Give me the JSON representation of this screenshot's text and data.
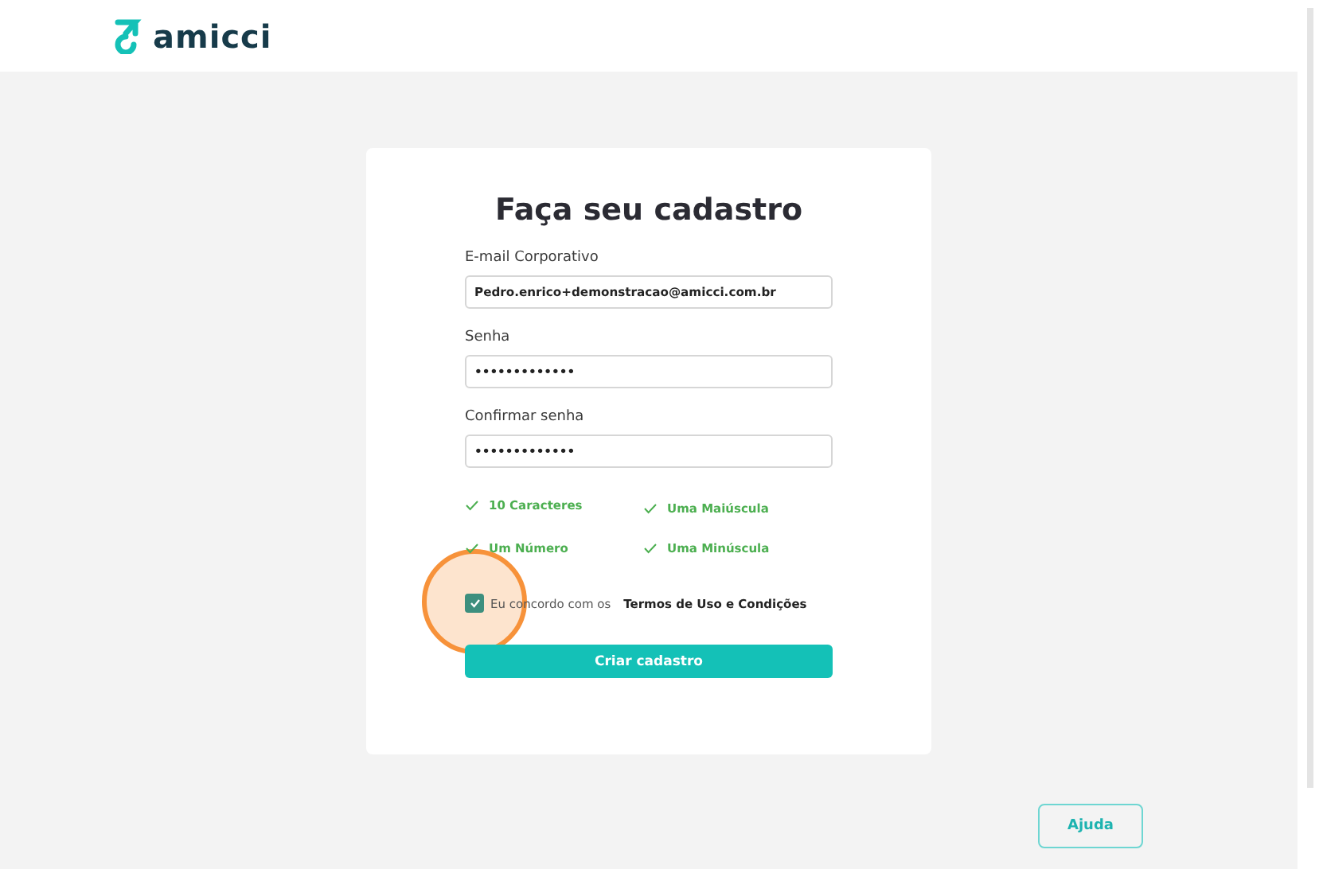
{
  "header": {
    "logo_text": "amicci"
  },
  "form": {
    "title": "Faça seu cadastro",
    "fields": [
      {
        "label": "E-mail Corporativo",
        "value": "Pedro.enrico+demonstracao@amicci.com.br"
      },
      {
        "label": "Senha",
        "value": "•••••••••••••"
      },
      {
        "label": "Confirmar senha",
        "value": "•••••••••••••"
      }
    ],
    "rules": [
      {
        "label": "10 Caracteres",
        "checked": true
      },
      {
        "label": "Uma Maiúscula",
        "checked": true
      },
      {
        "label": "Um Número",
        "checked": true
      },
      {
        "label": "Uma Minúscula",
        "checked": true
      }
    ],
    "terms": {
      "checked": true,
      "text": "Eu concordo com os",
      "link": "Termos de Uso e Condições"
    },
    "submit": "Criar cadastro"
  },
  "help_button": "Ajuda"
}
